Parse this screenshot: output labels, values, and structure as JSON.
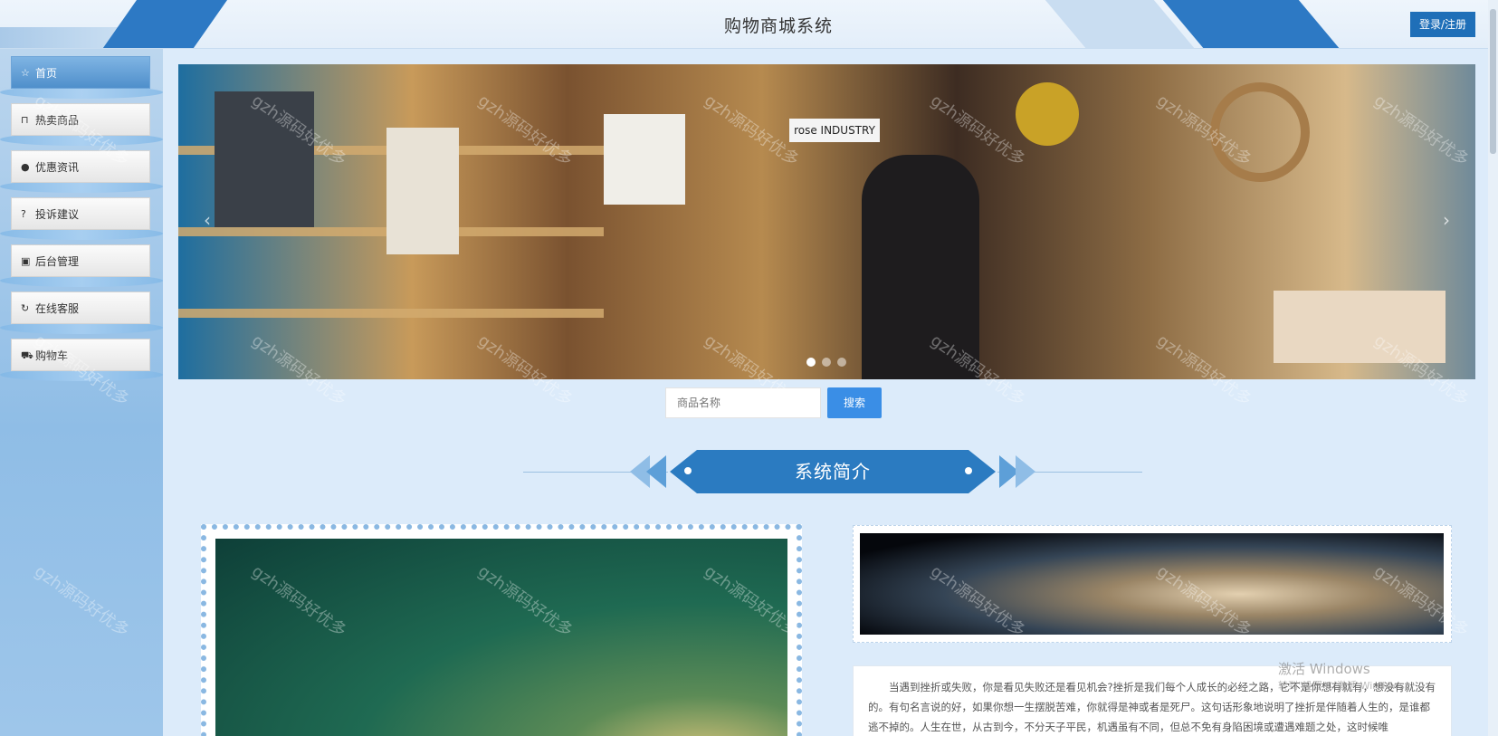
{
  "header": {
    "title": "购物商城系统",
    "login_label": "登录/注册"
  },
  "sidebar": {
    "items": [
      {
        "label": "首页",
        "icon": "star-icon"
      },
      {
        "label": "热卖商品",
        "icon": "bag-icon"
      },
      {
        "label": "优惠资讯",
        "icon": "info-icon"
      },
      {
        "label": "投诉建议",
        "icon": "question-icon"
      },
      {
        "label": "后台管理",
        "icon": "briefcase-icon"
      },
      {
        "label": "在线客服",
        "icon": "refresh-icon"
      },
      {
        "label": "购物车",
        "icon": "cart-icon"
      }
    ],
    "active_index": 0
  },
  "banner": {
    "store_sign": "rose INDUSTRY",
    "slide_count": 3,
    "active_slide": 1
  },
  "search": {
    "placeholder": "商品名称",
    "button_label": "搜索"
  },
  "section": {
    "title": "系统简介"
  },
  "intro": {
    "text": "当遇到挫折或失败，你是看见失败还是看见机会?挫折是我们每个人成长的必经之路，它不是你想有就有，想没有就没有的。有句名言说的好，如果你想一生摆脱苦难，你就得是神或者是死尸。这句话形象地说明了挫折是伴随着人生的，是谁都逃不掉的。人生在世，从古到今，不分天子平民，机遇虽有不同，但总不免有身陷困境或遭遇难题之处，这时候唯"
  },
  "watermark": "gzh源码好优多",
  "windows_activation": {
    "title": "激活 Windows",
    "subtitle": "转到\"设置\"以激活 Windows。"
  },
  "colors": {
    "primary": "#2b7bc1",
    "button": "#3a8ee6",
    "login": "#1f6fb8"
  }
}
